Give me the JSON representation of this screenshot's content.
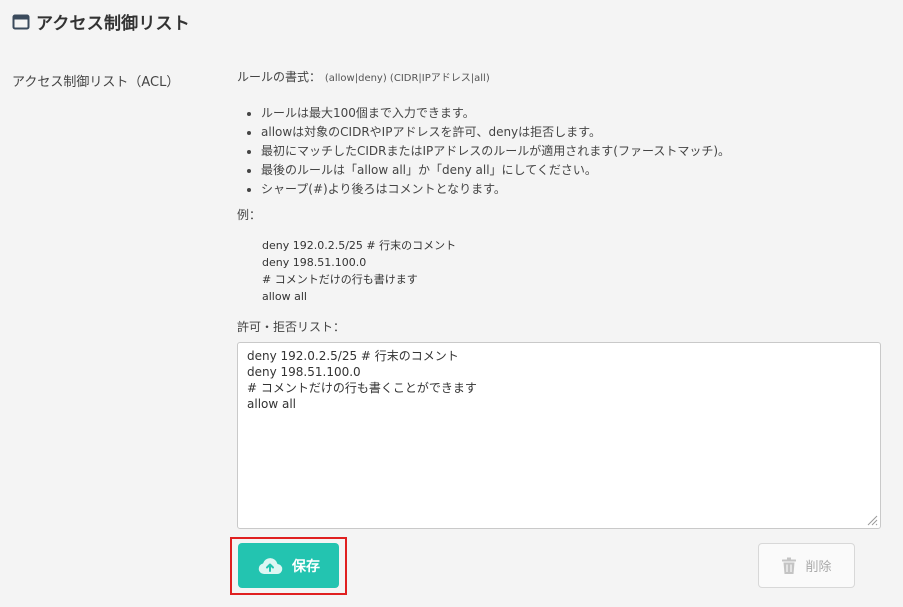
{
  "header": {
    "title": "アクセス制御リスト",
    "icon": "window-icon"
  },
  "form": {
    "label": "アクセス制御リスト（ACL）",
    "syntax_label": "ルールの書式：",
    "syntax_format": "(allow|deny) (CIDR|IPアドレス|all)",
    "rules": [
      "ルールは最大100個まで入力できます。",
      "allowは対象のCIDRやIPアドレスを許可、denyは拒否します。",
      "最初にマッチしたCIDRまたはIPアドレスのルールが適用されます(ファーストマッチ)。",
      "最後のルールは「allow all」か「deny all」にしてください。",
      "シャープ(#)より後ろはコメントとなります。"
    ],
    "example_label": "例：",
    "example_lines": [
      "deny 192.0.2.5/25 # 行末のコメント",
      "deny 198.51.100.0",
      "# コメントだけの行も書けます",
      "allow all"
    ],
    "list_label": "許可・拒否リスト：",
    "list_value": "deny 192.0.2.5/25 # 行末のコメント\ndeny 198.51.100.0\n# コメントだけの行も書くことができます\nallow all"
  },
  "actions": {
    "save_label": "保存",
    "save_icon": "cloud-upload-icon",
    "delete_label": "削除",
    "delete_icon": "trash-icon",
    "delete_disabled": true
  },
  "colors": {
    "accent": "#23c4b0",
    "highlight": "#e02020",
    "background": "#f4f4f4"
  }
}
